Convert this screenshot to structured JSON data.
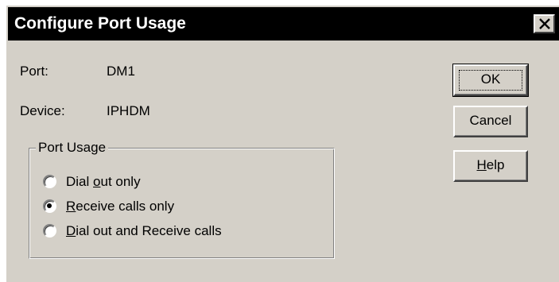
{
  "window": {
    "title": "Configure Port Usage",
    "close_icon": "close-icon"
  },
  "info": {
    "port_label": "Port:",
    "port_value": "DM1",
    "device_label": "Device:",
    "device_value": "IPHDM"
  },
  "port_usage": {
    "group_label": "Port Usage",
    "options": [
      {
        "pre": "Dial ",
        "key": "o",
        "post": "ut only",
        "selected": false
      },
      {
        "pre": "",
        "key": "R",
        "post": "eceive calls only",
        "selected": true
      },
      {
        "pre": "",
        "key": "D",
        "post": "ial out and Receive calls",
        "selected": false
      }
    ]
  },
  "buttons": {
    "ok_label": "OK",
    "cancel_label": "Cancel",
    "help_key": "H",
    "help_rest": "elp"
  }
}
